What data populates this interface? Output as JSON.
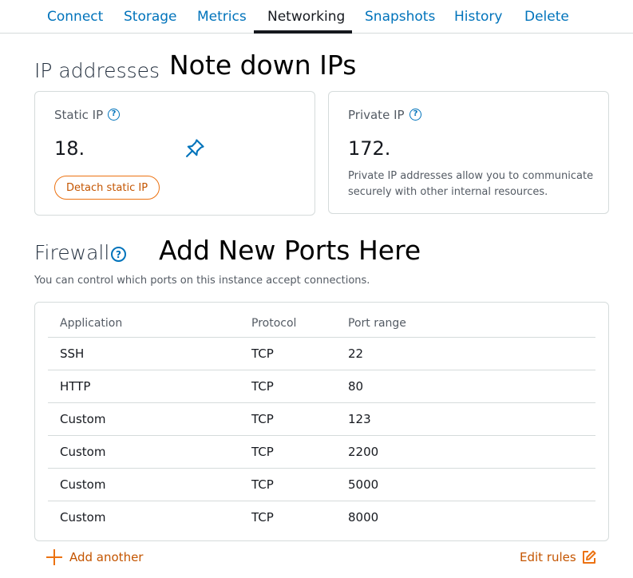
{
  "tabs": [
    "Connect",
    "Storage",
    "Metrics",
    "Networking",
    "Snapshots",
    "History",
    "Delete"
  ],
  "active_tab": "Networking",
  "ip_section": {
    "title": "IP addresses",
    "annotation": "Note down IPs",
    "static_ip": {
      "label": "Static IP",
      "help": "?",
      "value": "18.",
      "pin_icon": "pin-icon",
      "detach_label": "Detach static IP"
    },
    "private_ip": {
      "label": "Private IP",
      "help": "?",
      "value": "172.",
      "description": "Private IP addresses allow you to communicate securely with other internal resources."
    }
  },
  "firewall": {
    "title": "Firewall",
    "help": "?",
    "annotation": "Add New Ports Here",
    "description": "You can control which ports on this instance accept connections.",
    "columns": [
      "Application",
      "Protocol",
      "Port range"
    ],
    "rows": [
      [
        "SSH",
        "TCP",
        "22"
      ],
      [
        "HTTP",
        "TCP",
        "80"
      ],
      [
        "Custom",
        "TCP",
        "123"
      ],
      [
        "Custom",
        "TCP",
        "2200"
      ],
      [
        "Custom",
        "TCP",
        "5000"
      ],
      [
        "Custom",
        "TCP",
        "8000"
      ]
    ],
    "add_label": "Add another",
    "edit_label": "Edit rules"
  },
  "colors": {
    "link_blue": "#0073bb",
    "accent_orange": "#ec7211",
    "orange_text": "#c45500",
    "border": "#d5dbdb"
  }
}
